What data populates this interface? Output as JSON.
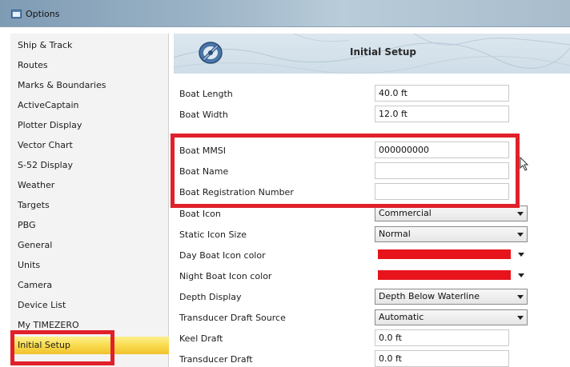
{
  "window": {
    "title": "Options"
  },
  "sidebar": {
    "items": [
      {
        "label": "Ship & Track"
      },
      {
        "label": "Routes"
      },
      {
        "label": "Marks & Boundaries"
      },
      {
        "label": "ActiveCaptain"
      },
      {
        "label": "Plotter Display"
      },
      {
        "label": "Vector Chart"
      },
      {
        "label": "S-52 Display"
      },
      {
        "label": "Weather"
      },
      {
        "label": "Targets"
      },
      {
        "label": "PBG"
      },
      {
        "label": "General"
      },
      {
        "label": "Units"
      },
      {
        "label": "Camera"
      },
      {
        "label": "Device List"
      },
      {
        "label": "My TIMEZERO"
      },
      {
        "label": "Initial Setup",
        "active": true
      }
    ]
  },
  "header": {
    "title": "Initial Setup",
    "icon": "gear-wrench-icon"
  },
  "fields": {
    "boat_length": {
      "label": "Boat Length",
      "value": "40.0 ft"
    },
    "boat_width": {
      "label": "Boat Width",
      "value": "12.0 ft"
    },
    "boat_mmsi": {
      "label": "Boat MMSI",
      "value": "000000000"
    },
    "boat_name": {
      "label": "Boat Name",
      "value": ""
    },
    "boat_registration": {
      "label": "Boat Registration Number",
      "value": ""
    },
    "boat_icon": {
      "label": "Boat Icon",
      "value": "Commercial"
    },
    "static_icon_size": {
      "label": "Static Icon Size",
      "value": "Normal"
    },
    "day_boat_icon_color": {
      "label": "Day Boat Icon color",
      "color": "#e8141c"
    },
    "night_boat_icon_color": {
      "label": "Night Boat Icon color",
      "color": "#e8141c"
    },
    "depth_display": {
      "label": "Depth Display",
      "value": "Depth Below Waterline"
    },
    "transducer_draft_source": {
      "label": "Transducer Draft Source",
      "value": "Automatic"
    },
    "keel_draft": {
      "label": "Keel Draft",
      "value": "0.0 ft"
    },
    "transducer_draft": {
      "label": "Transducer Draft",
      "value": "0.0 ft"
    }
  },
  "colors": {
    "highlight": "#e0202a",
    "active_item": "#f8d94a",
    "title_bar": "#9bb3c6"
  }
}
